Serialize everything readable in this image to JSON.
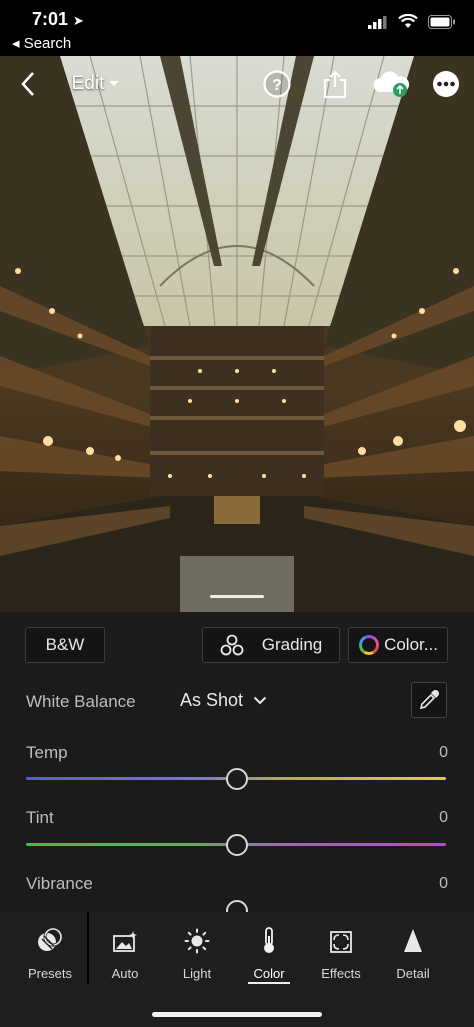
{
  "status_bar": {
    "time": "7:01",
    "back_app": "◂ Search"
  },
  "topbar": {
    "edit_label": "Edit"
  },
  "panel": {
    "bw_button": "B&W",
    "grading_button": "Grading",
    "color_button": "Color...",
    "white_balance": {
      "label": "White Balance",
      "value": "As Shot"
    },
    "sliders": [
      {
        "label": "Temp",
        "value": "0"
      },
      {
        "label": "Tint",
        "value": "0"
      },
      {
        "label": "Vibrance",
        "value": "0"
      }
    ]
  },
  "toolbar": {
    "items": [
      {
        "label": "Presets",
        "icon": "presets-icon"
      },
      {
        "label": "Auto",
        "icon": "auto-icon"
      },
      {
        "label": "Light",
        "icon": "light-icon"
      },
      {
        "label": "Color",
        "icon": "color-icon",
        "active": true
      },
      {
        "label": "Effects",
        "icon": "effects-icon"
      },
      {
        "label": "Detail",
        "icon": "detail-icon"
      }
    ]
  },
  "colors": {
    "background": "#1b1b1b",
    "temp_gradient": [
      "#5a5ad8",
      "#d8d23c"
    ],
    "tint_gradient": [
      "#3fbf4a",
      "#b44ad0"
    ]
  }
}
